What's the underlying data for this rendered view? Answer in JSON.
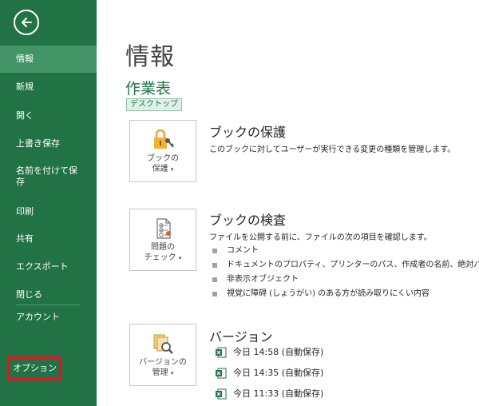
{
  "sidebar": {
    "items": [
      {
        "label": "情報"
      },
      {
        "label": "新規"
      },
      {
        "label": "開く"
      },
      {
        "label": "上書き保存"
      },
      {
        "label": "名前を付けて保存"
      },
      {
        "label": "印刷"
      },
      {
        "label": "共有"
      },
      {
        "label": "エクスポート"
      },
      {
        "label": "閉じる"
      },
      {
        "label": "アカウント"
      },
      {
        "label": "オプション"
      }
    ],
    "active_item": "情報",
    "highlighted_item": "オプション",
    "colors": {
      "background": "#217346",
      "active": "#439467",
      "highlight_border": "#e81123"
    }
  },
  "main": {
    "title": "情報",
    "document": {
      "name": "作業表",
      "location": "デスクトップ"
    },
    "sections": [
      {
        "button": {
          "label_line1": "ブックの",
          "label_line2": "保護",
          "dropdown": "▾"
        },
        "title": "ブックの保護",
        "description": "このブックに対してユーザーが実行できる変更の種類を管理します。"
      },
      {
        "button": {
          "label_line1": "問題の",
          "label_line2": "チェック",
          "dropdown": "▾"
        },
        "title": "ブックの検査",
        "description": "ファイルを公開する前に、ファイルの次の項目を確認します。",
        "items": [
          "コメント",
          "ドキュメントのプロパティ、プリンターのパス、作成者の名前、絶対パス",
          "非表示オブジェクト",
          "視覚に障碍 (しょうがい) のある方が読み取りにくい内容"
        ]
      },
      {
        "button": {
          "label_line1": "バージョンの",
          "label_line2": "管理",
          "dropdown": "▾"
        },
        "title": "バージョン",
        "versions": [
          "今日 14:58 (自動保存)",
          "今日 14:35 (自動保存)",
          "今日 11:33 (自動保存)"
        ]
      }
    ]
  }
}
